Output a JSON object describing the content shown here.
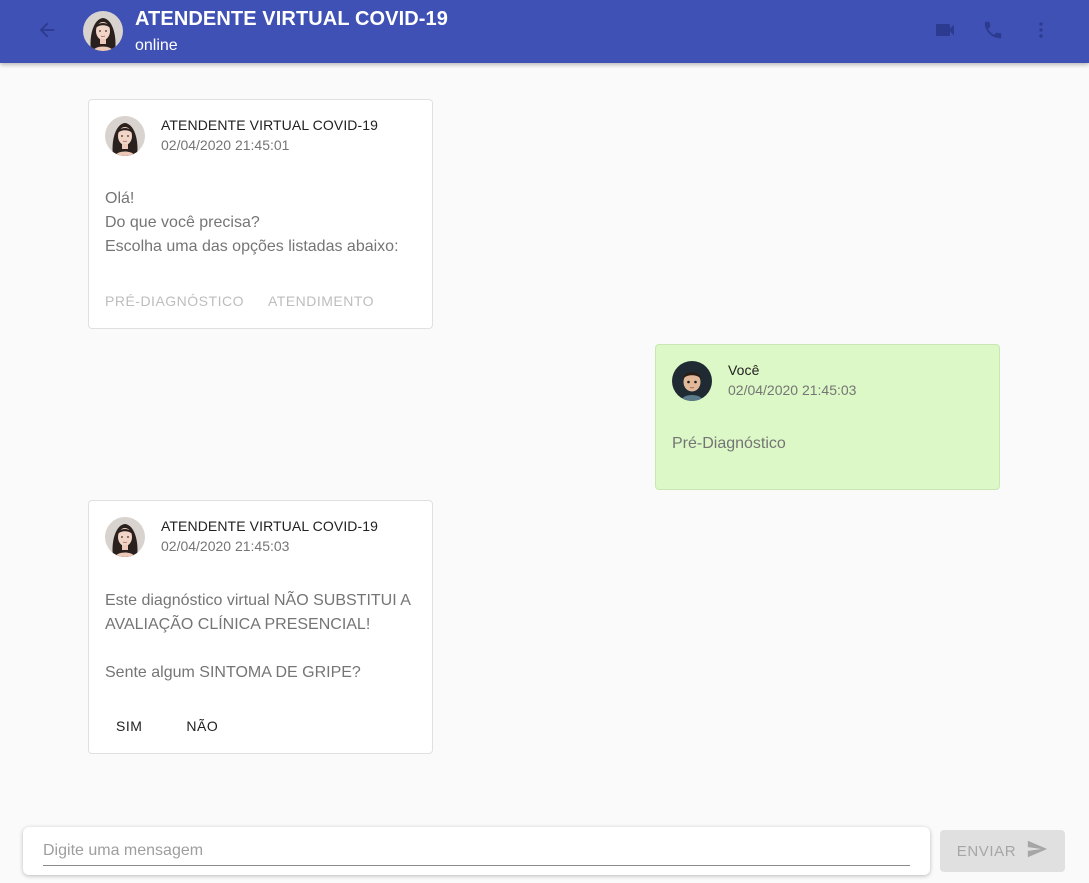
{
  "header": {
    "title": "ATENDENTE VIRTUAL COVID-19",
    "status": "online",
    "icons": [
      "arrow-back-icon",
      "videocam-icon",
      "phone-icon",
      "more-vert-icon"
    ],
    "color": "#3f51b5"
  },
  "messages": [
    {
      "sender": "ATENDENTE VIRTUAL COVID-19",
      "time": "02/04/2020 21:45:01",
      "lines": [
        "Olá!",
        "Do que você precisa?",
        "Escolha uma das opções listadas abaixo:"
      ],
      "actions": [
        "PRÉ-DIAGNÓSTICO",
        "ATENDIMENTO"
      ]
    },
    {
      "sender": "Você",
      "time": "02/04/2020 21:45:03",
      "lines": [
        "Pré-Diagnóstico"
      ]
    },
    {
      "sender": "ATENDENTE VIRTUAL COVID-19",
      "time": "02/04/2020 21:45:03",
      "lines": [
        "Este diagnóstico virtual NÃO SUBSTITUI A",
        "AVALIAÇÃO CLÍNICA PRESENCIAL!",
        "",
        "Sente algum SINTOMA DE GRIPE?"
      ],
      "actions": [
        "SIM",
        "NÃO"
      ]
    }
  ],
  "composer": {
    "placeholder": "Digite uma mensagem",
    "send_label": "ENVIAR"
  },
  "colors": {
    "user_bubble": "#dcf8c6",
    "bot_bubble": "#ffffff",
    "background": "#fafafa"
  }
}
